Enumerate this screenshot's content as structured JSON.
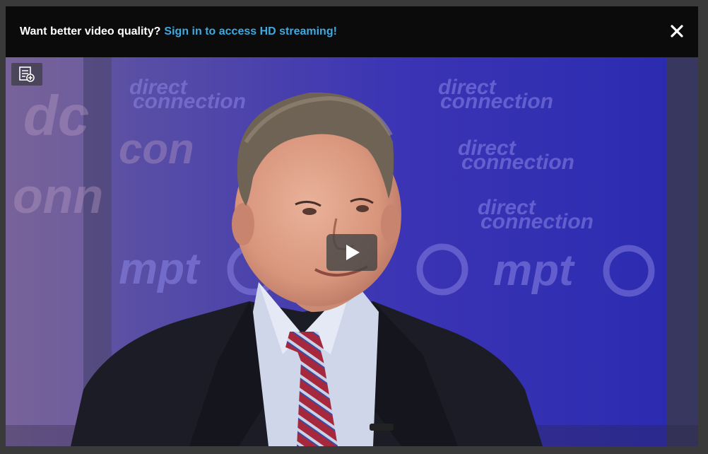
{
  "banner": {
    "prompt": "Want better video quality?",
    "link_label": "Sign in to access HD streaming!"
  },
  "video": {
    "backdrop_logo_text": "direct connection",
    "backdrop_brand_text": "mpt"
  },
  "colors": {
    "link": "#3fa9e0",
    "banner_bg": "#0b0b0b",
    "studio_blue": "#3b36a8"
  },
  "icons": {
    "close": "close-icon",
    "chapters": "chapters-list-icon",
    "play": "play-icon"
  }
}
